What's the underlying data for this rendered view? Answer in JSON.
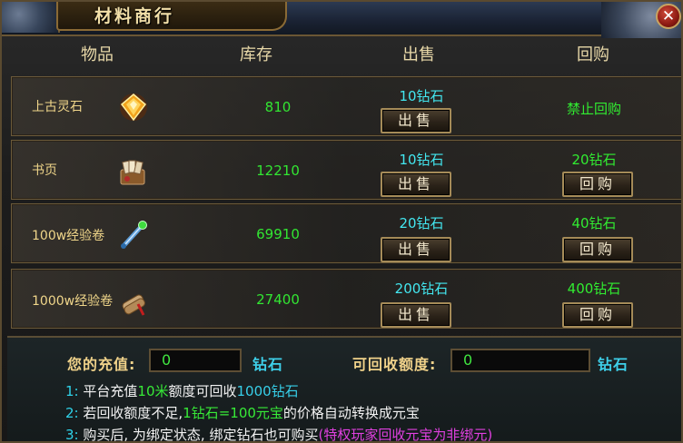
{
  "window": {
    "title": "材料商行",
    "close_icon": "✕"
  },
  "headers": {
    "item": "物品",
    "stock": "库存",
    "sell": "出售",
    "buyback": "回购"
  },
  "rows": [
    {
      "name": "上古灵石",
      "icon": "gem-icon",
      "stock": "810",
      "sell_price": "10钻石",
      "sell_label": "出售",
      "buyback_price": "禁止回购",
      "buyback_label": null
    },
    {
      "name": "书页",
      "icon": "book-pages-icon",
      "stock": "12210",
      "sell_price": "10钻石",
      "sell_label": "出售",
      "buyback_price": "20钻石",
      "buyback_label": "回购"
    },
    {
      "name": "100w经验卷",
      "icon": "scroll-green-icon",
      "stock": "69910",
      "sell_price": "20钻石",
      "sell_label": "出售",
      "buyback_price": "40钻石",
      "buyback_label": "回购"
    },
    {
      "name": "1000w经验卷",
      "icon": "scroll-bundle-icon",
      "stock": "27400",
      "sell_price": "200钻石",
      "sell_label": "出售",
      "buyback_price": "400钻石",
      "buyback_label": "回购"
    }
  ],
  "recharge": {
    "label": "您的充值:",
    "value": "0",
    "unit": "钻石"
  },
  "recyclable": {
    "label": "可回收额度:",
    "value": "0",
    "unit": "钻石"
  },
  "notes": [
    {
      "num": "1:",
      "parts": [
        "平台充值",
        "10米",
        "额度可回收",
        "1000钻石"
      ]
    },
    {
      "num": "2:",
      "parts": [
        "若回收额度不足,",
        "1钻石=100元宝",
        "的价格自动转换成元宝"
      ]
    },
    {
      "num": "3:",
      "parts": [
        "购买后, 为绑定状态, 绑定钻石也可购买",
        "(特权玩家回收元宝为非绑元)"
      ]
    }
  ],
  "colors": {
    "gold_text": "#f0d68a",
    "green": "#32e632",
    "cyan": "#43e7f0",
    "magenta": "#e040e0"
  }
}
